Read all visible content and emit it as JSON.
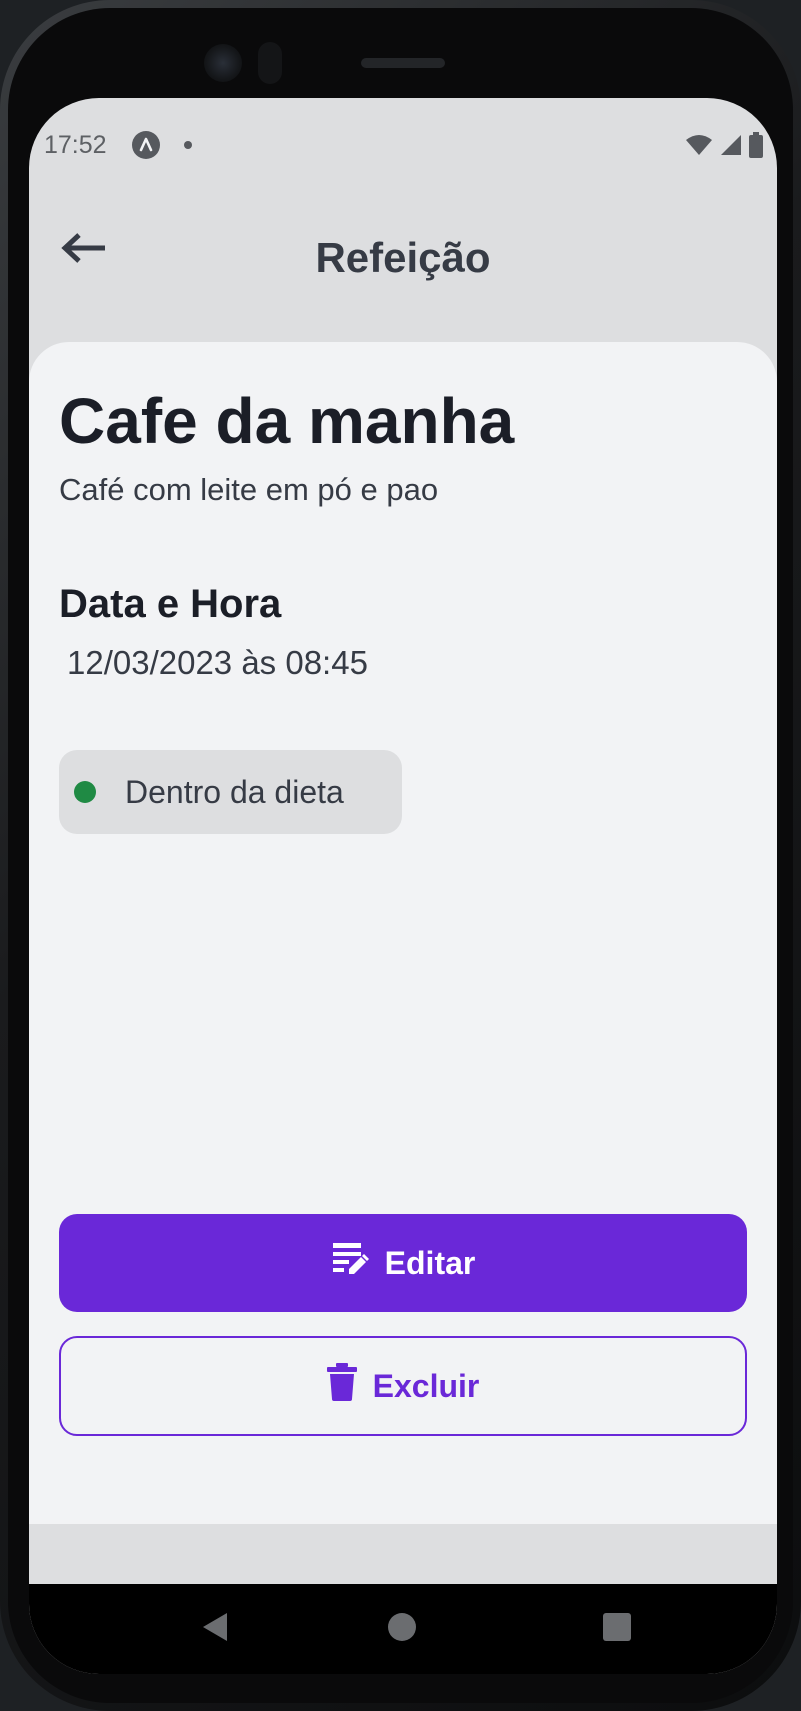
{
  "status_bar": {
    "time": "17:52",
    "icons": [
      "app-notification-icon",
      "dot-icon",
      "wifi-icon",
      "signal-icon",
      "battery-icon"
    ]
  },
  "header": {
    "title": "Refeição",
    "back_icon": "arrow-left-icon"
  },
  "meal": {
    "name": "Cafe da manha",
    "description": "Café com leite em pó e pao",
    "datetime_label": "Data e Hora",
    "datetime_value": "12/03/2023 às 08:45",
    "diet_status": {
      "label": "Dentro da dieta",
      "color": "#1f8a44"
    }
  },
  "actions": {
    "edit_label": "Editar",
    "edit_icon": "edit-note-icon",
    "delete_label": "Excluir",
    "delete_icon": "trash-icon"
  },
  "colors": {
    "primary": "#6a28d8",
    "text_dark": "#1b1e27",
    "text_muted": "#363b45",
    "card_bg": "#f2f3f5",
    "screen_bg": "#dddee0",
    "in_diet": "#1f8a44"
  },
  "nav_bar": {
    "buttons": [
      "back-triangle-icon",
      "home-circle-icon",
      "recents-square-icon"
    ]
  }
}
